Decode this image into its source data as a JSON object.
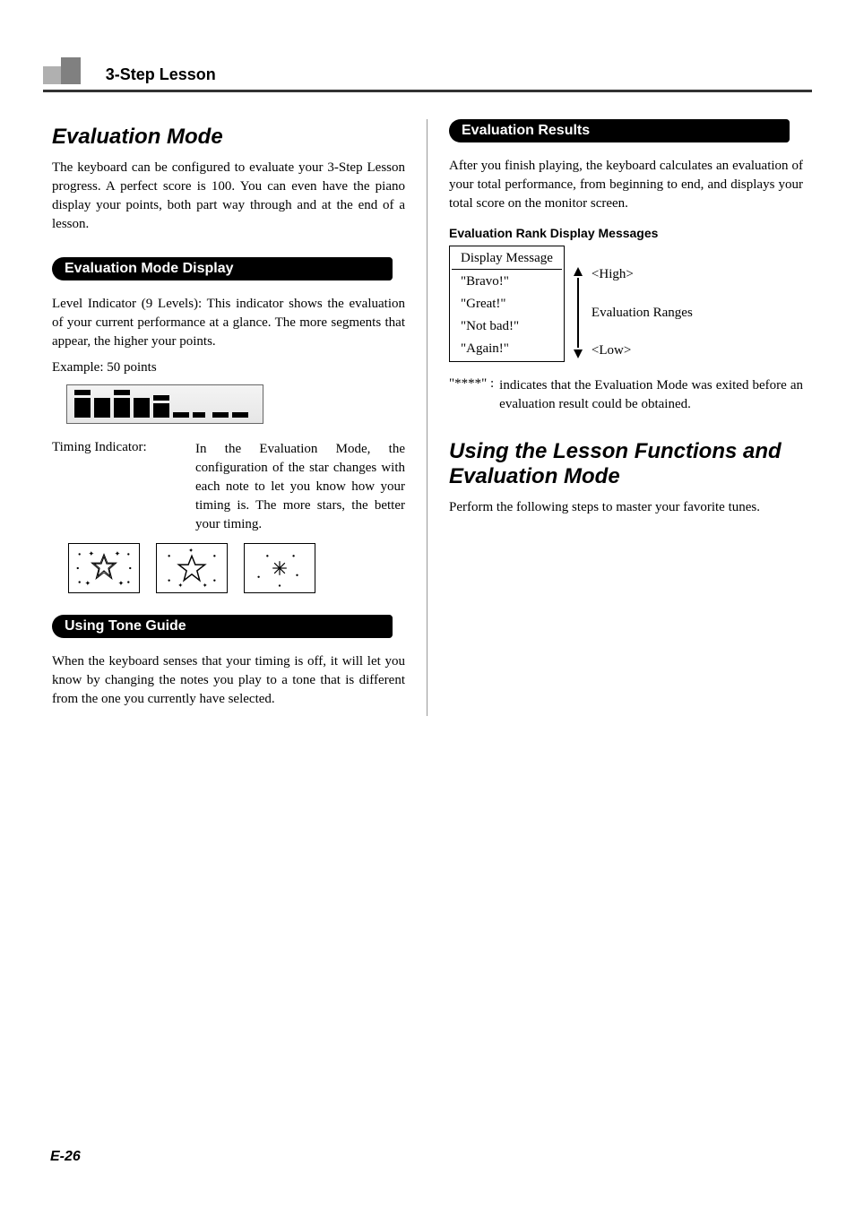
{
  "header": {
    "chapter_title": "3-Step Lesson"
  },
  "left": {
    "section_title": "Evaluation Mode",
    "intro": "The keyboard can be configured to evaluate your 3-Step Lesson progress. A perfect score is 100. You can even have the piano display your points, both part way through and at the end of a lesson.",
    "sub1": "Evaluation Mode Display",
    "level_indicator_text": "Level Indicator (9 Levels): This indicator shows the evaluation of your current performance at a glance. The more segments that appear, the higher your points.",
    "example_label": "Example: 50 points",
    "timing_term": "Timing Indicator:",
    "timing_desc": "In the Evaluation Mode, the configuration of the star changes with each note to let you know how your timing is. The more stars, the better your timing.",
    "sub2": "Using Tone Guide",
    "tone_guide_text": "When the keyboard senses that your timing is off, it will let you know by changing the notes you play to a tone that is different from the one you currently have selected."
  },
  "right": {
    "sub1": "Evaluation Results",
    "results_intro": "After you finish playing, the keyboard calculates an evaluation of your total performance, from beginning to end, and displays your total score on the monitor screen.",
    "rank_heading": "Evaluation Rank Display Messages",
    "rank_table_header": "Display Message",
    "ranks": [
      "\"Bravo!\"",
      "\"Great!\"",
      "\"Not bad!\"",
      "\"Again!\""
    ],
    "range_high": "<High>",
    "range_mid": "Evaluation Ranges",
    "range_low": "<Low>",
    "asterisk_label": "\"****\" :",
    "asterisk_text": "indicates that the Evaluation Mode was exited before an evaluation result could be obtained.",
    "section2_title": "Using the Lesson Functions and Evaluation Mode",
    "section2_text": "Perform the following steps to master your favorite tunes."
  },
  "footer": {
    "page_number": "E-26"
  }
}
